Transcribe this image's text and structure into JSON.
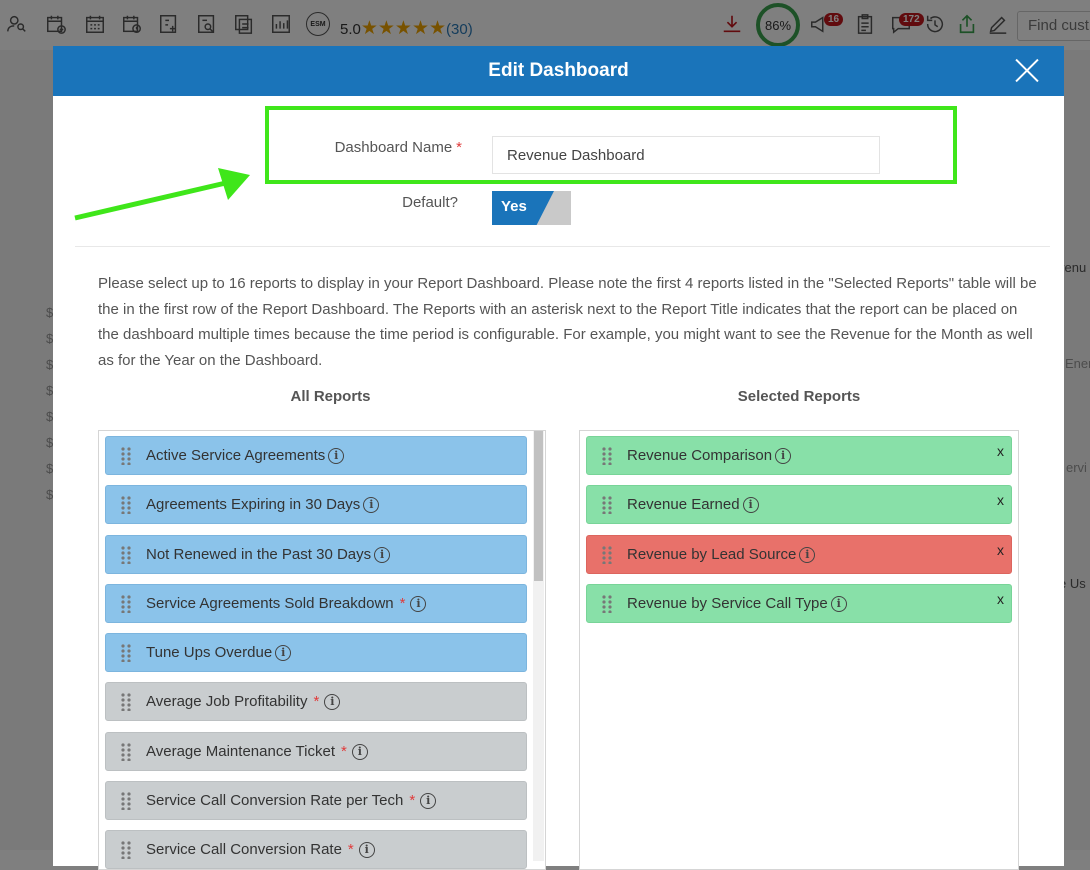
{
  "toolbar": {
    "rating_value": "5.0",
    "rating_stars": "★★★★★",
    "rating_count": "(30)",
    "esm_label": "ESM",
    "progress": "86%",
    "notifications_badge": "16",
    "messages_badge": "172",
    "search_placeholder": "Find cust"
  },
  "modal": {
    "title": "Edit Dashboard",
    "dashboard_name_label": "Dashboard Name",
    "required_mark": "*",
    "dashboard_name_value": "Revenue Dashboard",
    "default_label": "Default?",
    "default_toggle": "Yes",
    "description": "Please select up to 16 reports to display in your Report Dashboard. Please note the first 4 reports listed in the \"Selected Reports\" table will be the in the first row of the Report Dashboard. The Reports with an asterisk next to the Report Title indicates that the report can be placed on the dashboard multiple times because the time period is configurable. For example, you might want to see the Revenue for the Month as well as for the Year on the Dashboard.",
    "all_reports_title": "All Reports",
    "selected_reports_title": "Selected Reports",
    "all_reports": [
      {
        "label": "Active Service Agreements",
        "asterisk": false,
        "color": "blue"
      },
      {
        "label": "Agreements Expiring in 30 Days",
        "asterisk": false,
        "color": "blue"
      },
      {
        "label": "Not Renewed in the Past 30 Days",
        "asterisk": false,
        "color": "blue"
      },
      {
        "label": "Service Agreements Sold Breakdown",
        "asterisk": true,
        "color": "blue"
      },
      {
        "label": "Tune Ups Overdue",
        "asterisk": false,
        "color": "blue"
      },
      {
        "label": "Average Job Profitability",
        "asterisk": true,
        "color": "grey"
      },
      {
        "label": "Average Maintenance Ticket",
        "asterisk": true,
        "color": "grey"
      },
      {
        "label": "Service Call Conversion Rate per Tech",
        "asterisk": true,
        "color": "grey"
      },
      {
        "label": "Service Call Conversion Rate",
        "asterisk": true,
        "color": "grey"
      }
    ],
    "selected_reports": [
      {
        "label": "Revenue Comparison",
        "color": "green",
        "remove": "x"
      },
      {
        "label": "Revenue Earned",
        "color": "green",
        "remove": "x"
      },
      {
        "label": "Revenue by Lead Source",
        "color": "red",
        "remove": "x"
      },
      {
        "label": "Revenue by Service Call Type",
        "color": "green",
        "remove": "x"
      }
    ],
    "info_glyph": "i"
  },
  "background": {
    "right_top": "venu",
    "right_mid1": "Ener",
    "right_mid2": "ervi",
    "right_bottom": "e Us",
    "dollar": "$"
  },
  "colors": {
    "header_blue": "#1a74ba",
    "highlight_green": "#3fe61a",
    "item_blue": "#8bc3ea",
    "item_grey": "#c9cdcf",
    "item_green": "#88e0a8",
    "item_red": "#e8716a"
  }
}
